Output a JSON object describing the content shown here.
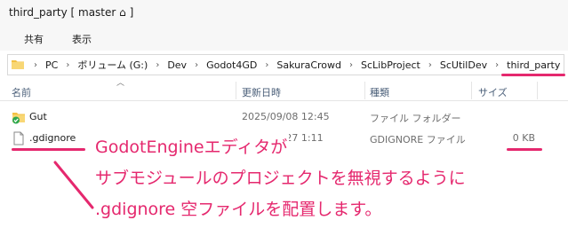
{
  "window": {
    "title": "third_party [ master ⌂ ]"
  },
  "ribbon": {
    "tabs": [
      "共有",
      "表示"
    ]
  },
  "address": {
    "crumbs": [
      "PC",
      "ボリューム (G:)",
      "Dev",
      "Godot4GD",
      "SakuraCrowd",
      "ScLibProject",
      "ScUtilDev",
      "third_party"
    ],
    "current": "third_party"
  },
  "columns": {
    "name": "名前",
    "date": "更新日時",
    "type": "種類",
    "size": "サイズ"
  },
  "files": [
    {
      "name": "Gut",
      "date": "2025/09/08 12:45",
      "type": "ファイル フォルダー",
      "size": "",
      "icon": "folder-synced-icon"
    },
    {
      "name": ".gdignore",
      "date": "2025/07/27 1:11",
      "type": "GDIGNORE ファイル",
      "size": "0 KB",
      "icon": "file-icon"
    }
  ],
  "annotation": {
    "line1": "GodotEngineエディタが",
    "line2": "サブモジュールのプロジェクトを無視するように",
    "line3": ".gdignore 空ファイルを配置します。"
  },
  "colors": {
    "accent": "#e5286e",
    "header_text": "#4c607a",
    "folder": "#f3c144",
    "sync_check": "#2fa84f"
  }
}
